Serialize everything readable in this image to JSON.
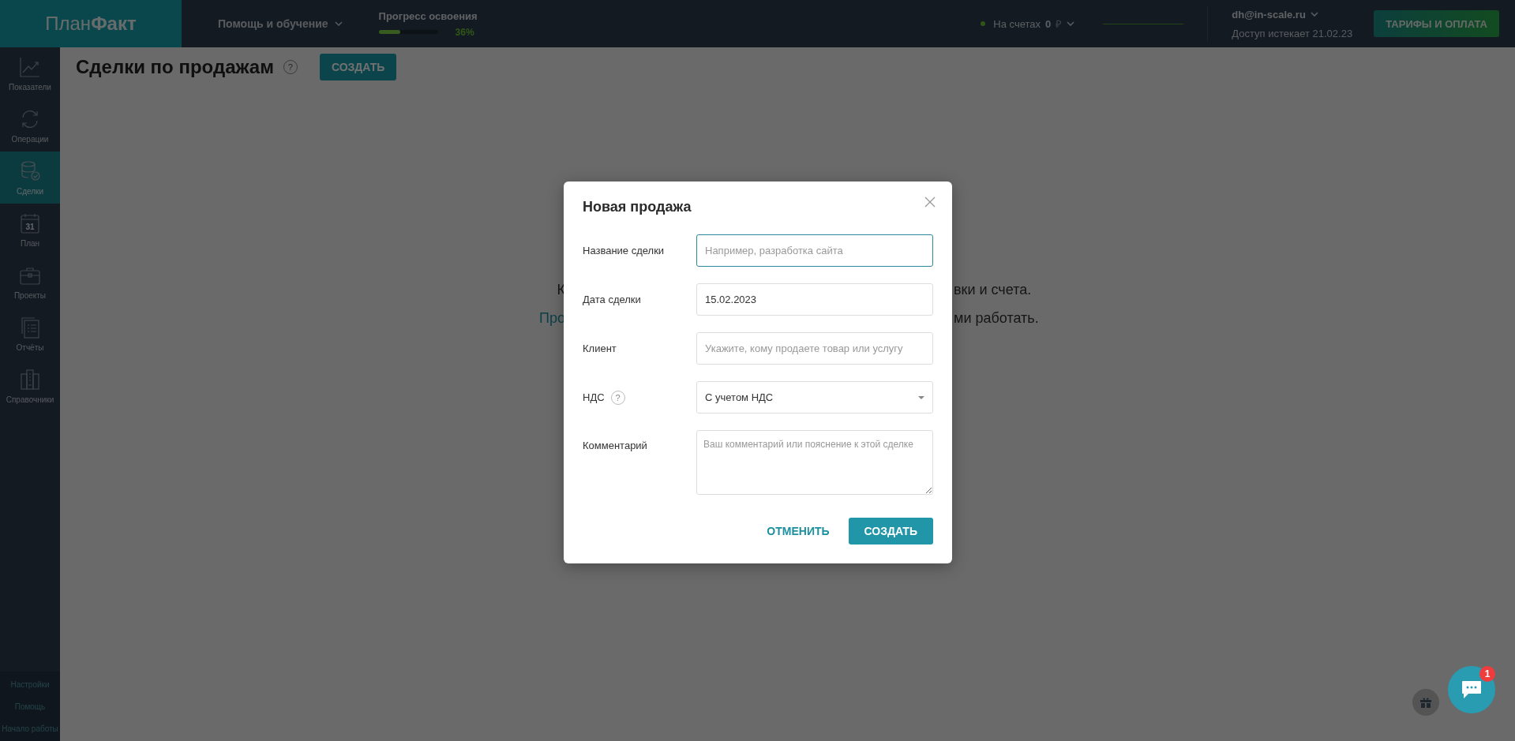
{
  "topbar": {
    "logo": "План**Факт**",
    "help_menu": "Помощь и обучение",
    "progress": {
      "label": "Прогресс освоения",
      "level": 0.36,
      "percent": "36%"
    },
    "balance": {
      "label": "На счетах",
      "amount": "0",
      "currency": "₽"
    },
    "user": {
      "email": "dh@in-scale.ru",
      "access": "Доступ истекает 21.02.23"
    },
    "plans_button": "ТАРИФЫ И ОПЛАТА"
  },
  "sidebar": {
    "items": [
      {
        "label": "Показатели",
        "selected": false
      },
      {
        "label": "Операции",
        "selected": false
      },
      {
        "label": "Сделки",
        "selected": true
      },
      {
        "label": "План",
        "selected": false,
        "icon_label": "31"
      },
      {
        "label": "Проекты",
        "selected": false
      },
      {
        "label": "Отчёты",
        "selected": false
      },
      {
        "label": "Справочники",
        "selected": false
      }
    ],
    "footer": [
      "Настройки",
      "Помощь",
      "Начало работы"
    ]
  },
  "page": {
    "title": "Сделки по продажам",
    "help": "?",
    "create_button": "СОЗДАТЬ",
    "empty_state": [
      {
        "left": {
          "text": "К",
          "kind": "text"
        },
        "right": {
          "text": "вки и счета.",
          "kind": "text"
        }
      },
      {
        "left": {
          "text": "Про",
          "kind": "link"
        },
        "right": {
          "text": "ми работать.",
          "kind": "text"
        }
      }
    ]
  },
  "modal": {
    "title": "Новая продажа",
    "fields": [
      {
        "label": "Название сделки",
        "kind": "text",
        "placeholder": "Например, разработка сайта",
        "focused": true
      },
      {
        "label": "Дата сделки",
        "kind": "text",
        "value": "15.02.2023",
        "focused": false
      },
      {
        "label": "Клиент",
        "kind": "text",
        "placeholder": "Укажите, кому продаете товар или услугу",
        "focused": false
      },
      {
        "label": "НДС",
        "help": "?",
        "kind": "select",
        "value": "С учетом НДС",
        "focused": false
      },
      {
        "label": "Комментарий",
        "kind": "textarea",
        "placeholder": "Ваш комментарий или пояснение к этой сделке",
        "focused": false
      }
    ],
    "cancel_button": "ОТМЕНИТЬ",
    "submit_button": "СОЗДАТЬ"
  },
  "chat": {
    "badge": "1"
  }
}
